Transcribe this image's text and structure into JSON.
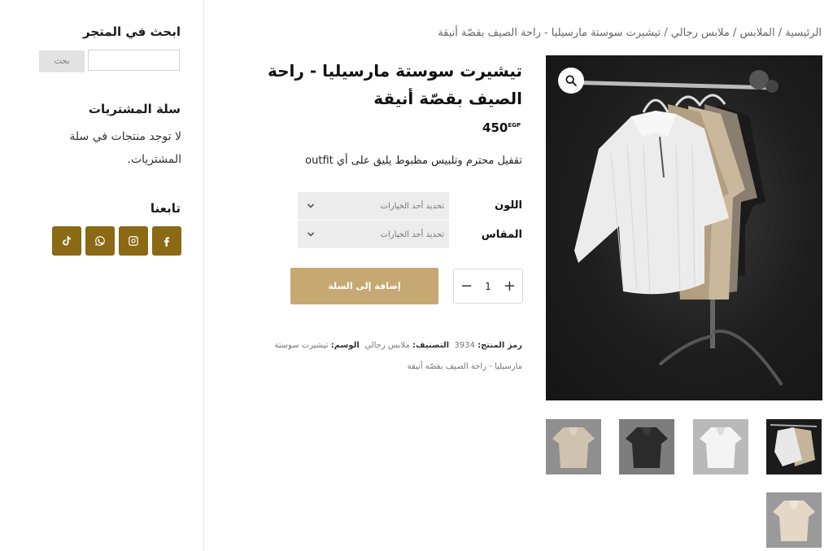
{
  "breadcrumb": "الرئيسية / الملابس / ملابس رجالي / تيشيرت سوستة مارسيليا - راحة الصيف بقصّة أنيقة",
  "product": {
    "title": "تيشيرت سوستة مارسيليا - راحة الصيف بقصّة أنيقة",
    "price": "450",
    "currency": "EGP",
    "description": "تقفيل محترم وتلبيس مظبوط يليق على أي outfit",
    "color_label": "اللون",
    "size_label": "المقاس",
    "select_placeholder": "تحديد أحد الخيارات",
    "quantity": "1",
    "add_to_cart": "إضافة إلى السلة",
    "meta": {
      "sku_label": "رمز المنتج:",
      "sku": "3934",
      "category_label": "التصنيف:",
      "category": "ملابس رجالي",
      "tag_label": "الوسم:",
      "tag": "تيشيرت سوستة مارسيليا - راحة الصيف بقصّة أنيقة"
    }
  },
  "sidebar": {
    "search_heading": "ابحث في المتجر",
    "search_button": "بحث",
    "cart_heading": "سلة المشتريات",
    "cart_empty": "لا توجد منتجات في سلة المشتريات.",
    "follow_heading": "تابعنا",
    "social_icons": [
      "facebook-icon",
      "instagram-icon",
      "whatsapp-icon",
      "tiktok-icon"
    ]
  },
  "colors": {
    "accent": "#8a6a14",
    "add_button": "#c6a873"
  }
}
